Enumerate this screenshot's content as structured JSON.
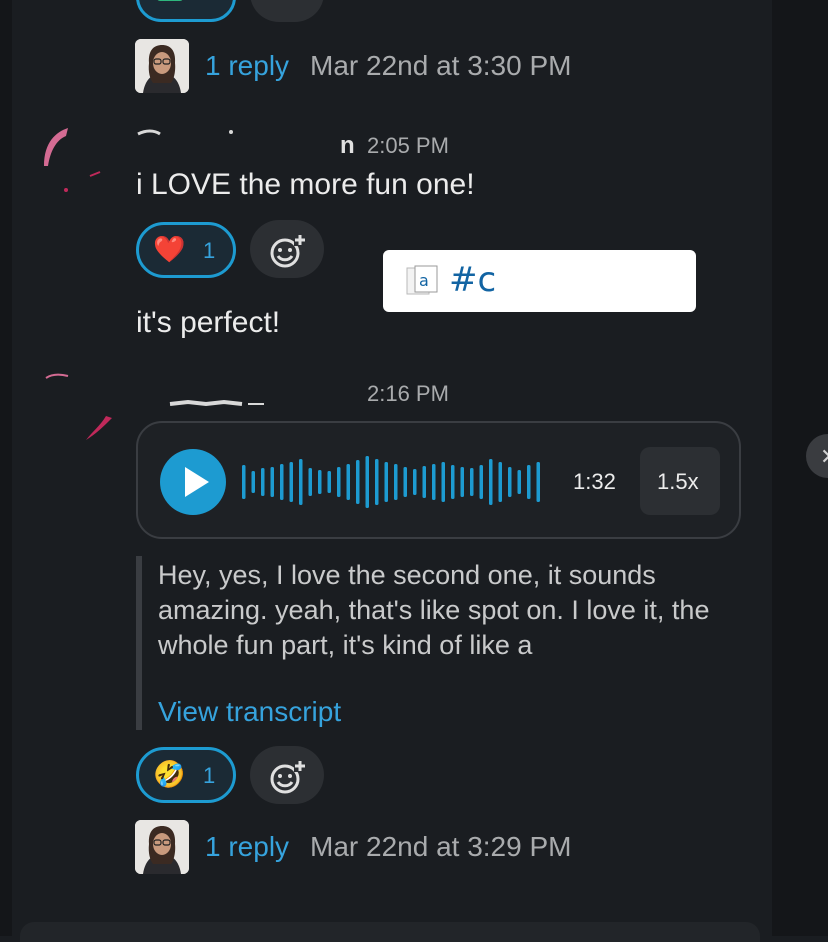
{
  "thread_summary_top": {
    "reply_count": "1 reply",
    "reply_time": "Mar 22nd at 3:30 PM"
  },
  "message_1": {
    "time": "2:05 PM",
    "text": "i LOVE the more fun one!",
    "reaction": {
      "emoji": "❤️",
      "count": "1"
    },
    "followup_text": "it's perfect!"
  },
  "popover": {
    "text": "#c"
  },
  "message_2": {
    "time": "2:16 PM",
    "voice_clip": {
      "duration": "1:32",
      "speed": "1.5x"
    },
    "transcript": {
      "text": "Hey, yes, I love the second one, it sounds amazing. yeah, that's like spot on. I love it, the whole fun part, it's kind of like a",
      "view_label": "View transcript"
    },
    "reaction": {
      "emoji": "🤣",
      "count": "1"
    }
  },
  "thread_summary_bottom": {
    "reply_count": "1 reply",
    "reply_time": "Mar 22nd at 3:29 PM"
  },
  "colors": {
    "background": "#1a1d21",
    "accent_blue": "#1d9bd1",
    "link_blue": "#36a3dd",
    "muted_text": "#a9abad"
  }
}
